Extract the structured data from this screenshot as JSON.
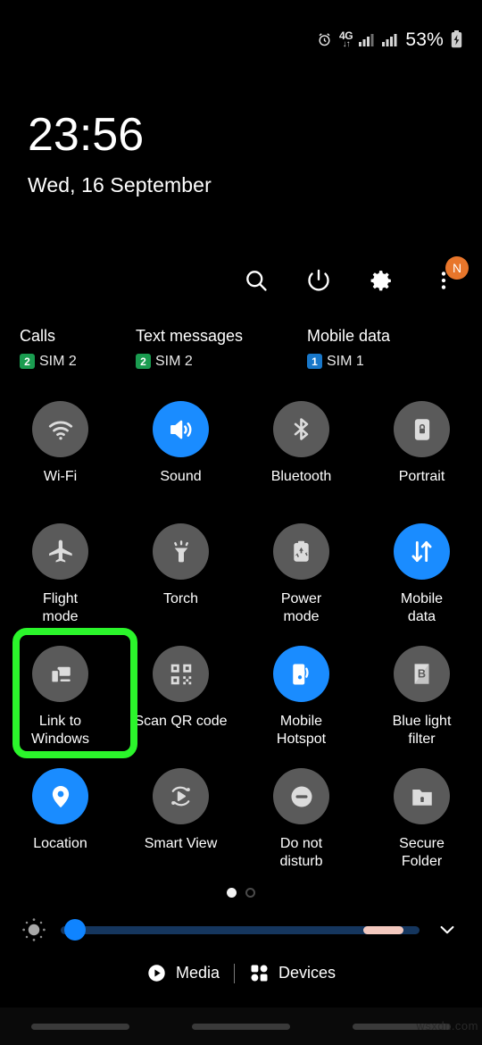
{
  "status_bar": {
    "alarm_icon": "alarm-clock-icon",
    "network_type": "4G",
    "data_arrows": "↓↑",
    "signal_1_icon": "signal-bars-icon",
    "signal_2_icon": "signal-bars-icon",
    "battery_percent": "53%",
    "battery_icon": "battery-charging-icon"
  },
  "clock": {
    "time": "23:56",
    "date": "Wed, 16 September"
  },
  "actions": [
    {
      "name": "search-icon",
      "label": "Search"
    },
    {
      "name": "power-icon",
      "label": "Power"
    },
    {
      "name": "gear-icon",
      "label": "Settings"
    },
    {
      "name": "more-options-icon",
      "label": "More options",
      "badge": "N"
    }
  ],
  "sim_status": [
    {
      "title": "Calls",
      "chip": "2",
      "sim": "SIM 2",
      "chip_color": "#1a9c50"
    },
    {
      "title": "Text messages",
      "chip": "2",
      "sim": "SIM 2",
      "chip_color": "#1a9c50"
    },
    {
      "title": "Mobile data",
      "chip": "1",
      "sim": "SIM 1",
      "chip_color": "#1877c9"
    }
  ],
  "tiles": [
    {
      "label": "Wi-Fi",
      "icon": "wifi-icon",
      "on": false
    },
    {
      "label": "Sound",
      "icon": "volume-icon",
      "on": true
    },
    {
      "label": "Bluetooth",
      "icon": "bluetooth-icon",
      "on": false
    },
    {
      "label": "Portrait",
      "icon": "rotation-lock-icon",
      "on": false
    },
    {
      "label": "Flight\nmode",
      "icon": "airplane-icon",
      "on": false
    },
    {
      "label": "Torch",
      "icon": "flashlight-icon",
      "on": false
    },
    {
      "label": "Power\nmode",
      "icon": "power-saving-icon",
      "on": false
    },
    {
      "label": "Mobile\ndata",
      "icon": "mobile-data-icon",
      "on": true
    },
    {
      "label": "Link to\nWindows",
      "icon": "link-to-windows-icon",
      "on": false,
      "highlighted": true
    },
    {
      "label": "Scan QR code",
      "icon": "qr-code-icon",
      "on": false
    },
    {
      "label": "Mobile\nHotspot",
      "icon": "hotspot-icon",
      "on": true
    },
    {
      "label": "Blue light\nfilter",
      "icon": "blue-light-icon",
      "on": false
    },
    {
      "label": "Location",
      "icon": "location-pin-icon",
      "on": true
    },
    {
      "label": "Smart View",
      "icon": "smart-view-icon",
      "on": false
    },
    {
      "label": "Do not\ndisturb",
      "icon": "do-not-disturb-icon",
      "on": false
    },
    {
      "label": "Secure\nFolder",
      "icon": "secure-folder-icon",
      "on": false
    }
  ],
  "pager": {
    "total": 2,
    "active_index": 0
  },
  "brightness": {
    "auto_icon": "auto-brightness-icon",
    "value_percent": 3,
    "warm_segment": true,
    "expand_icon": "chevron-down-icon"
  },
  "media_bar": {
    "media_label": "Media",
    "media_icon": "play-circle-icon",
    "devices_label": "Devices",
    "devices_icon": "devices-grid-icon"
  },
  "navbar": {
    "items": [
      "recents-pill",
      "home-pill",
      "back-pill"
    ]
  },
  "watermark": "wsxdn.com",
  "colors": {
    "background": "#000000",
    "tile_off": "#5a5a5a",
    "tile_on": "#1a8cff",
    "highlight": "#2bf52b",
    "badge": "#e8762b",
    "slider_track": "#15365e",
    "slider_warm": "#f3c9bf"
  }
}
